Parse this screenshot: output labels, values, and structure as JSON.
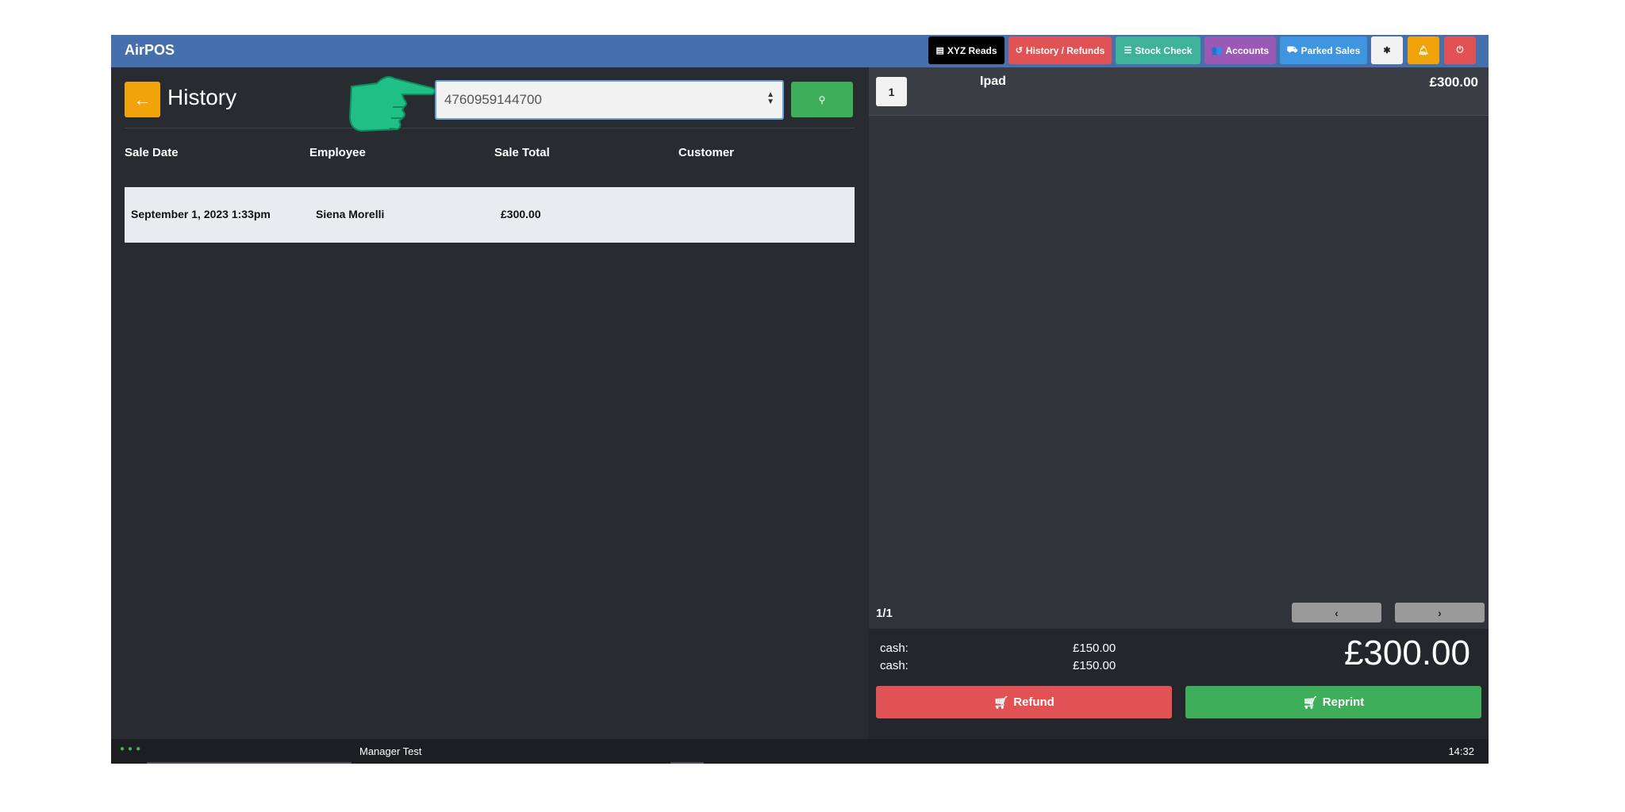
{
  "app": {
    "title": "AirPOS"
  },
  "toolbar": {
    "buttons": [
      {
        "label": "XYZ Reads",
        "icon": "keyboard-icon",
        "color": "#000000"
      },
      {
        "label": "History / Refunds",
        "icon": "history-icon",
        "color": "#e05253"
      },
      {
        "label": "Stock Check",
        "icon": "list-icon",
        "color": "#3fb39a"
      },
      {
        "label": "Accounts",
        "icon": "users-icon",
        "color": "#9b59b6"
      },
      {
        "label": "Parked Sales",
        "icon": "car-icon",
        "color": "#3f95e0"
      },
      {
        "label": "",
        "icon": "gear-icon",
        "color": "#f2f2f2"
      },
      {
        "label": "",
        "icon": "bell-icon",
        "color": "#f0a30a"
      },
      {
        "label": "",
        "icon": "power-icon",
        "color": "#e05253"
      }
    ]
  },
  "history": {
    "title": "History",
    "back_icon": "arrow-left-icon",
    "search_value": "4760959144700",
    "search_icon": "search-icon",
    "columns": [
      "Sale Date",
      "Employee",
      "Sale Total",
      "Customer"
    ],
    "rows": [
      {
        "date": "September 1, 2023 1:33pm",
        "employee": "Siena Morelli",
        "total": "£300.00",
        "customer": ""
      }
    ]
  },
  "sale": {
    "items": [
      {
        "qty": "1",
        "name": "Ipad",
        "price": "£300.00"
      }
    ],
    "pager": "1/1",
    "payments": [
      {
        "method": "cash:",
        "amount": "£150.00"
      },
      {
        "method": "cash:",
        "amount": "£150.00"
      }
    ],
    "total": "£300.00",
    "refund_label": "Refund",
    "reprint_label": "Reprint"
  },
  "status": {
    "user": "Manager Test",
    "time": "14:32"
  },
  "colors": {
    "topbar": "#456fad",
    "accent_green": "#3fae5a",
    "accent_red": "#e05253",
    "accent_orange": "#f0a30a"
  }
}
